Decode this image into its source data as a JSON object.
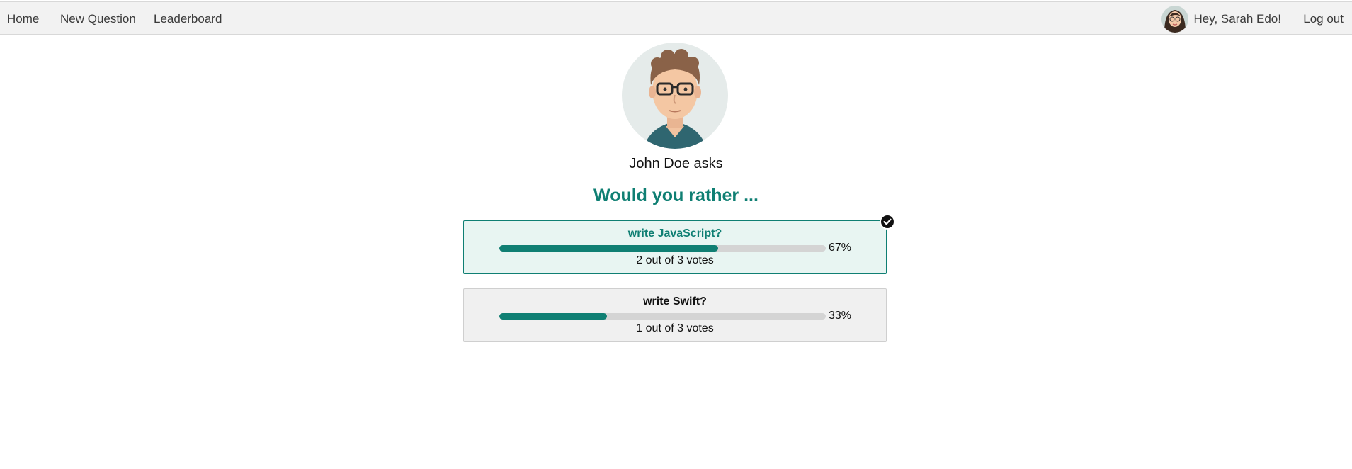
{
  "nav": {
    "home": "Home",
    "new_question": "New Question",
    "leaderboard": "Leaderboard",
    "greeting": "Hey, Sarah Edo!",
    "logout": "Log out"
  },
  "question": {
    "author_line": "John Doe asks",
    "headline": "Would you rather ...",
    "options": [
      {
        "text": "write JavaScript?",
        "percent_label": "67%",
        "votes_label": "2 out of 3 votes",
        "fraction": 0.67,
        "chosen": true
      },
      {
        "text": "write Swift?",
        "percent_label": "33%",
        "votes_label": "1 out of 3 votes",
        "fraction": 0.33,
        "chosen": false
      }
    ]
  },
  "icons": {
    "chosen_marker": "check-circle-icon",
    "user_avatar": "avatar-sarah",
    "author_avatar": "avatar-john"
  },
  "colors": {
    "accent": "#0f7f73",
    "chosen_background": "#e8f5f2",
    "option_background": "#f0f0f0",
    "navbar_background": "#f2f2f2"
  }
}
